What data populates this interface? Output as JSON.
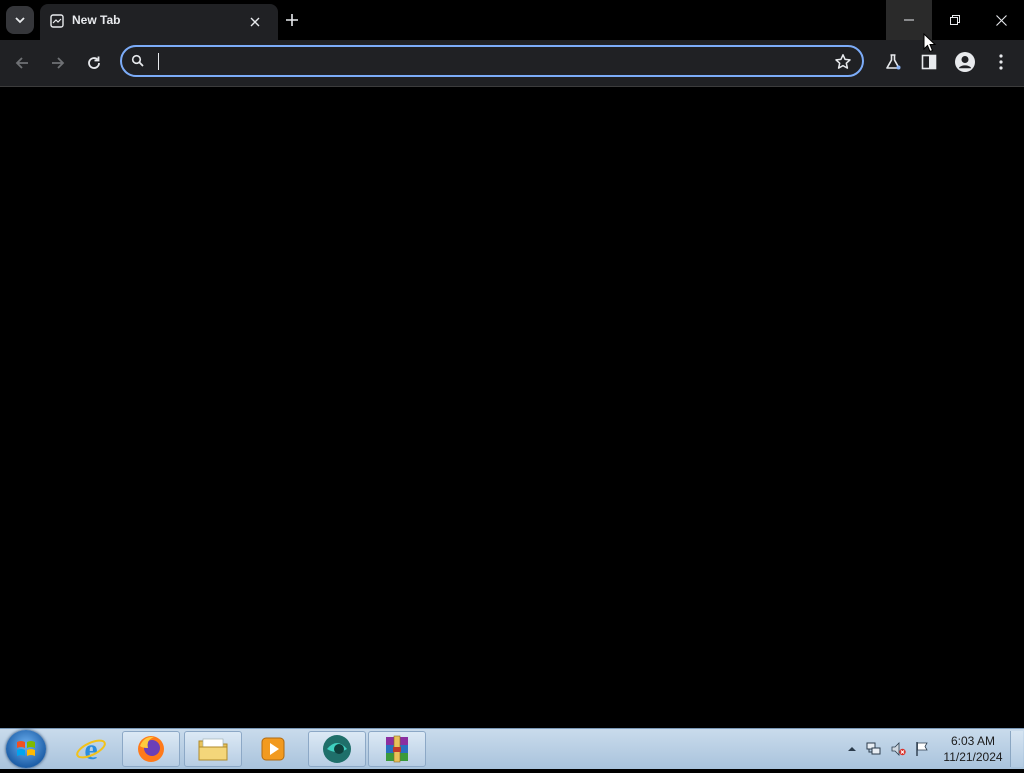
{
  "browser": {
    "tab": {
      "title": "New Tab"
    },
    "omnibox": {
      "value": "",
      "placeholder": ""
    }
  },
  "taskbar": {
    "apps": [
      {
        "name": "internet-explorer",
        "active": false
      },
      {
        "name": "firefox",
        "active": true
      },
      {
        "name": "file-explorer",
        "active": true
      },
      {
        "name": "media-player",
        "active": false
      },
      {
        "name": "chrome-like-browser",
        "active": true
      },
      {
        "name": "winrar",
        "active": true
      }
    ],
    "clock": {
      "time": "6:03 AM",
      "date": "11/21/2024"
    }
  },
  "colors": {
    "tab_bg": "#202124",
    "toolbar_bg": "#202124",
    "omnibox_focus": "#7cacf8",
    "content_bg": "#000000",
    "taskbar_top": "#c9dbec"
  }
}
